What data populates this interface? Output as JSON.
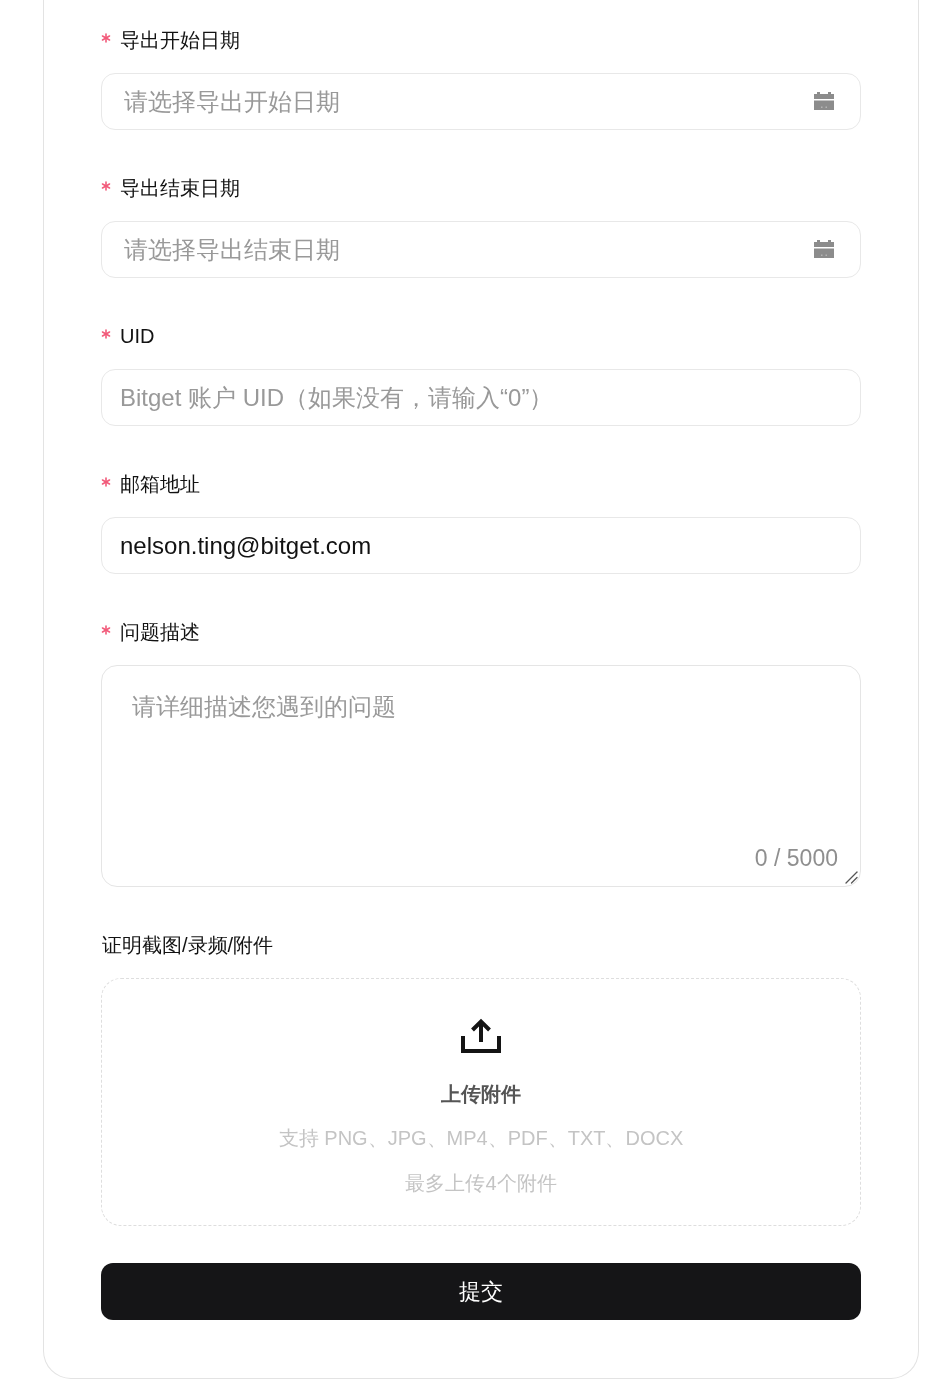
{
  "form": {
    "fields": [
      {
        "kind": "date",
        "label": "导出开始日期",
        "required": true,
        "placeholder": "请选择导出开始日期"
      },
      {
        "kind": "date",
        "label": "导出结束日期",
        "required": true,
        "placeholder": "请选择导出结束日期"
      },
      {
        "kind": "text",
        "label": "UID",
        "required": true,
        "placeholder": "Bitget 账户 UID（如果没有，请输入“0”）"
      },
      {
        "kind": "text",
        "label": "邮箱地址",
        "required": true,
        "value": "nelson.ting@bitget.com"
      },
      {
        "kind": "textarea",
        "label": "问题描述",
        "required": true,
        "placeholder": "请详细描述您遇到的问题",
        "counter": "0 / 5000"
      },
      {
        "kind": "upload",
        "label": "证明截图/录频/附件",
        "required": false,
        "title": "上传附件",
        "formats": "支持 PNG、JPG、MP4、PDF、TXT、DOCX",
        "limit": "最多上传4个附件"
      }
    ],
    "submit_button": "提交"
  }
}
